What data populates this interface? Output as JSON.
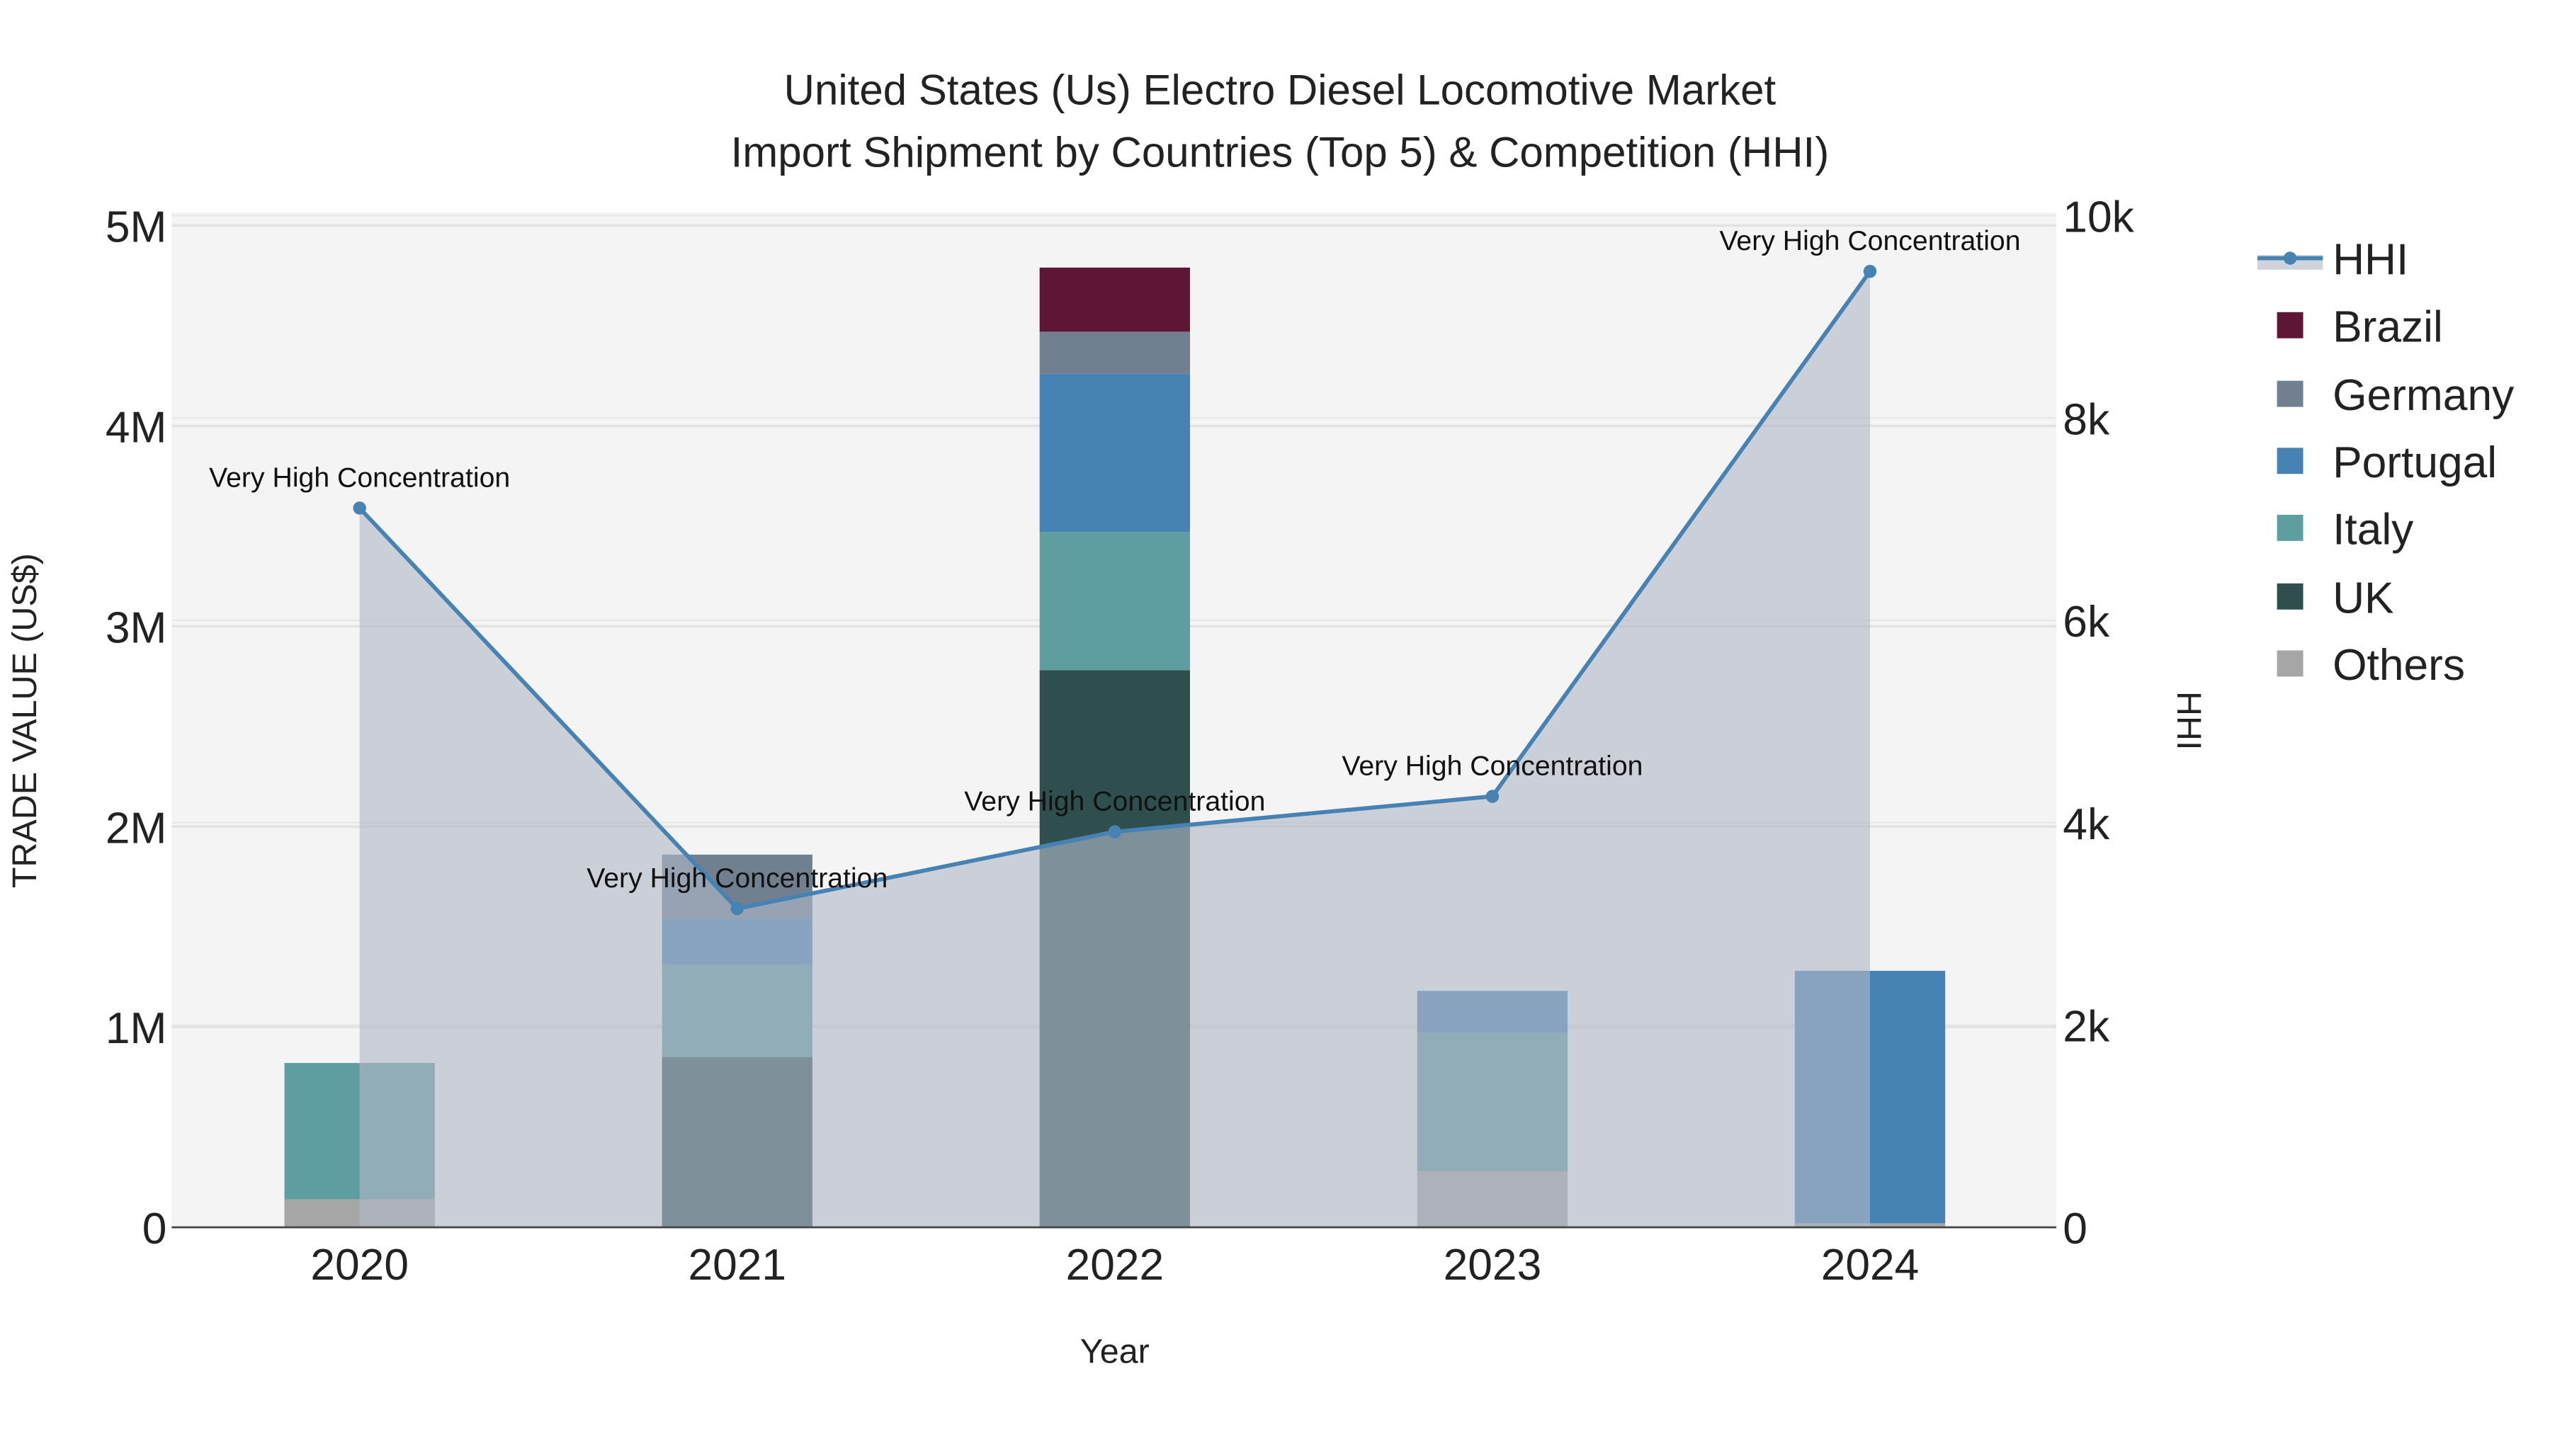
{
  "chart_data": {
    "type": "bar",
    "title": "United States (Us) Electro Diesel Locomotive Market",
    "subtitle": "Import Shipment by Countries (Top 5) & Competition (HHI)",
    "xlabel": "Year",
    "ylabel": "TRADE VALUE (US$)",
    "y2label": "HHI",
    "categories": [
      "2020",
      "2021",
      "2022",
      "2023",
      "2024"
    ],
    "ylim": [
      0,
      5000000
    ],
    "y2lim": [
      0,
      10000
    ],
    "yticks": [
      {
        "v": 0,
        "label": "0"
      },
      {
        "v": 1000000,
        "label": "1M"
      },
      {
        "v": 2000000,
        "label": "2M"
      },
      {
        "v": 3000000,
        "label": "3M"
      },
      {
        "v": 4000000,
        "label": "4M"
      },
      {
        "v": 5000000,
        "label": "5M"
      }
    ],
    "y2ticks": [
      {
        "v": 0,
        "label": "0"
      },
      {
        "v": 2000,
        "label": "2k"
      },
      {
        "v": 4000,
        "label": "4k"
      },
      {
        "v": 6000,
        "label": "6k"
      },
      {
        "v": 8000,
        "label": "8k"
      },
      {
        "v": 10000,
        "label": "10k"
      }
    ],
    "series": [
      {
        "name": "Others",
        "color": "#a6a6a6",
        "values": [
          140000,
          0,
          0,
          280000,
          20000
        ]
      },
      {
        "name": "UK",
        "color": "#2f4f4f",
        "values": [
          0,
          850000,
          2780000,
          0,
          0
        ]
      },
      {
        "name": "Italy",
        "color": "#5f9ea0",
        "values": [
          680000,
          460000,
          690000,
          690000,
          0
        ]
      },
      {
        "name": "Portugal",
        "color": "#4682b4",
        "values": [
          0,
          230000,
          790000,
          210000,
          1260000
        ]
      },
      {
        "name": "Germany",
        "color": "#708090",
        "values": [
          0,
          320000,
          210000,
          0,
          0
        ]
      },
      {
        "name": "Brazil",
        "color": "#5f1535",
        "values": [
          0,
          0,
          320000,
          0,
          0
        ]
      }
    ],
    "hhi": {
      "name": "HHI",
      "color": "#4682b4",
      "values": [
        7110,
        3150,
        3910,
        4260,
        9450
      ],
      "annotations": [
        "Very High Concentration",
        "Very High Concentration",
        "Very High Concentration",
        "Very High Concentration",
        "Very High Concentration"
      ]
    },
    "legend": [
      "HHI",
      "Brazil",
      "Germany",
      "Portugal",
      "Italy",
      "UK",
      "Others"
    ],
    "legend_position": "right",
    "grid": true
  }
}
